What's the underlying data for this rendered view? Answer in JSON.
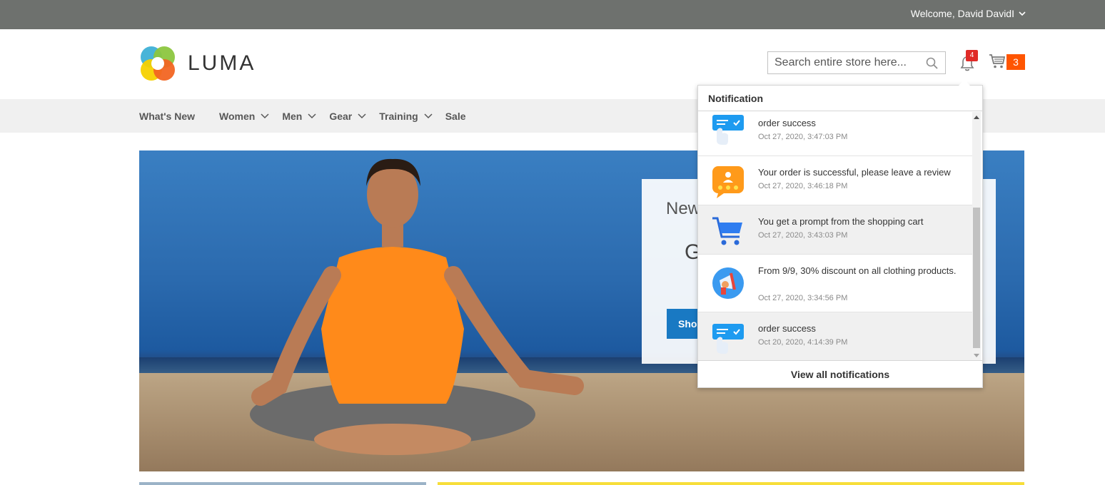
{
  "topbar": {
    "welcome": "Welcome, David DavidI"
  },
  "header": {
    "logo_text": "LUMA",
    "search_placeholder": "Search entire store here...",
    "notification_count": "4",
    "cart_count": "3"
  },
  "nav": {
    "items": [
      {
        "label": "What's New",
        "dropdown": false
      },
      {
        "label": "Women",
        "dropdown": true
      },
      {
        "label": "Men",
        "dropdown": true
      },
      {
        "label": "Gear",
        "dropdown": true
      },
      {
        "label": "Training",
        "dropdown": true
      },
      {
        "label": "Sale",
        "dropdown": false
      }
    ]
  },
  "hero": {
    "promo_line1": "New",
    "promo_line2": "G",
    "button_label": "Sho"
  },
  "notifications": {
    "title": "Notification",
    "footer": "View all notifications",
    "items": [
      {
        "icon": "order-success-icon",
        "text": "order success",
        "time": "Oct 27, 2020, 3:47:03 PM",
        "highlighted": false
      },
      {
        "icon": "review-icon",
        "text": "Your order is successful, please leave a review",
        "time": "Oct 27, 2020, 3:46:18 PM",
        "highlighted": false
      },
      {
        "icon": "shopping-cart-icon",
        "text": "You get a prompt from the shopping cart",
        "time": "Oct 27, 2020, 3:43:03 PM",
        "highlighted": true
      },
      {
        "icon": "megaphone-icon",
        "text": "From 9/9, 30% discount on all clothing products.",
        "time": "Oct 27, 2020, 3:34:56 PM",
        "highlighted": false
      },
      {
        "icon": "order-success-icon",
        "text": "order success",
        "time": "Oct 20, 2020, 4:14:39 PM",
        "highlighted": true
      }
    ]
  },
  "colors": {
    "topbar": "#6e716e",
    "nav_bg": "#f0f0f0",
    "badge_red": "#e02b27",
    "cart_orange": "#ff5501",
    "primary_blue": "#1979c3"
  }
}
